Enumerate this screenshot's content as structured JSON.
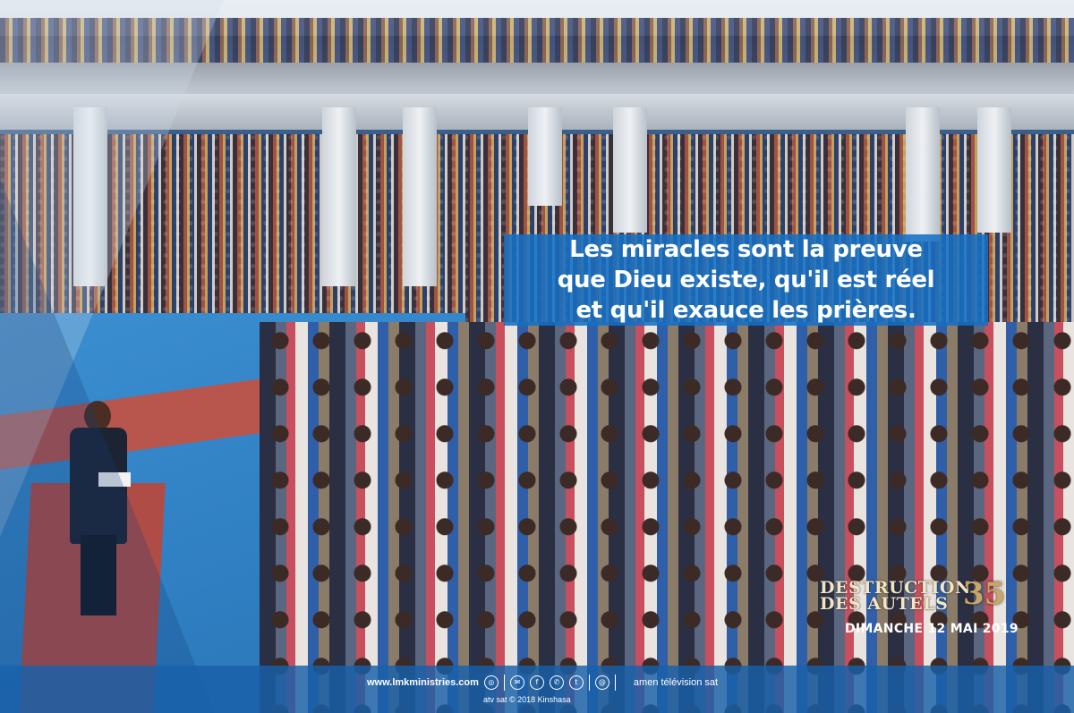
{
  "quote": {
    "text": "Les miracles sont la preuve\nque Dieu existe, qu'il est réel\net qu'il exauce les prières."
  },
  "event": {
    "title_line1": "DESTRUCTION",
    "title_line2": "DES AUTELS",
    "number": "35",
    "date": "DIMANCHE 12 MAI 2019"
  },
  "footer": {
    "website": "www.lmkministries.com",
    "social_icons": [
      "globe-icon",
      "mail-icon",
      "facebook-icon",
      "whatsapp-icon",
      "twitter-icon",
      "at-icon"
    ],
    "tv_label": "amen télévision sat",
    "copyright": "atv sat © 2018 Kinshasa"
  },
  "colors": {
    "banner_blue": "#1670c4",
    "footer_blue": "#1860aa",
    "event_gold": "#c9a56a"
  }
}
